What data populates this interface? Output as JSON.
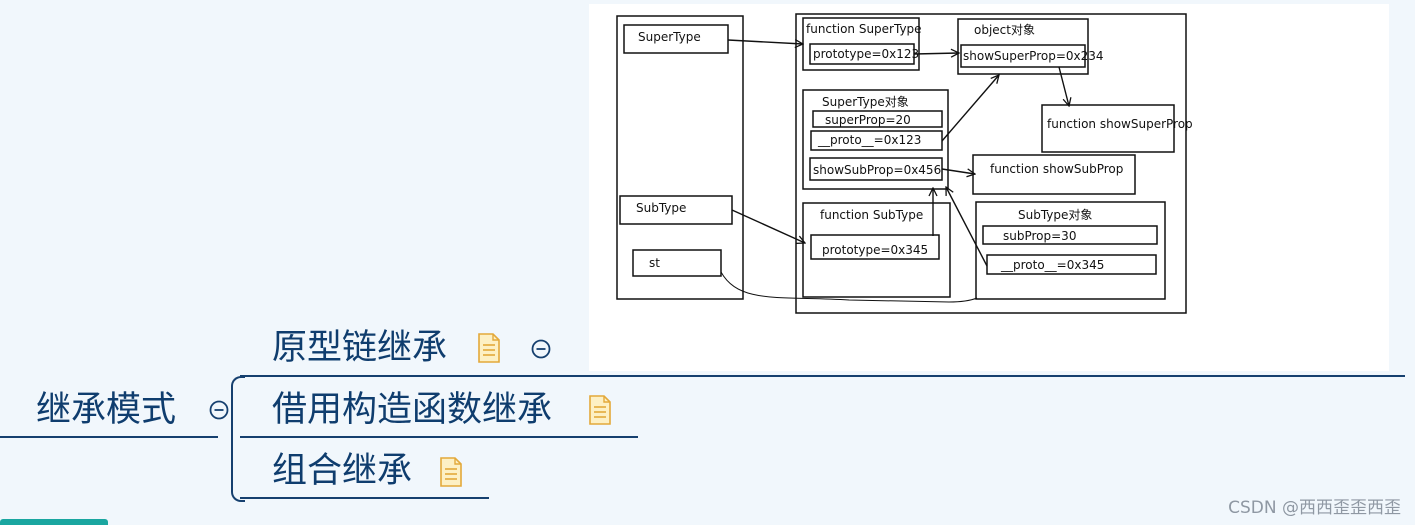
{
  "mindmap": {
    "root": {
      "label": "继承模式"
    },
    "children": [
      {
        "label": "原型链继承"
      },
      {
        "label": "借用构造函数继承"
      },
      {
        "label": "组合继承"
      }
    ]
  },
  "diagram": {
    "stack": {
      "supertype": "SuperType",
      "subtype": "SubType",
      "st": "st"
    },
    "heap": {
      "fn_supertype_title": "function SuperType",
      "fn_supertype_prototype": "prototype=0x123",
      "object_title": "object对象",
      "object_showsuperprop": "showSuperProp=0x234",
      "fn_showsuperprop": "function showSuperProp",
      "supertype_obj_title": "SuperType对象",
      "supertype_obj_superprop": "superProp=20",
      "supertype_obj_proto": "__proto__=0x123",
      "supertype_obj_showsubprop": "showSubProp=0x456",
      "fn_showsubprop": "function showSubProp",
      "fn_subtype_title": "function SubType",
      "fn_subtype_prototype": "prototype=0x345",
      "subtype_obj_title": "SubType对象",
      "subtype_obj_subprop": "subProp=30",
      "subtype_obj_proto": "__proto__=0x345"
    }
  },
  "watermark": "CSDN @西西歪歪西歪",
  "colors": {
    "background": "#f1f7fc",
    "node_text": "#0f3d6e",
    "connector": "#16406f",
    "note_icon_fill": "#fdf0c4",
    "note_icon_stroke": "#e3a93a"
  }
}
